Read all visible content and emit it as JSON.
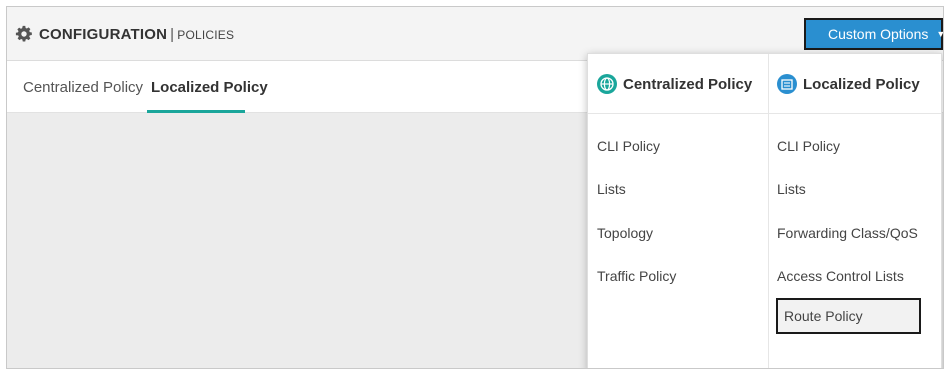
{
  "header": {
    "title_main": "CONFIGURATION",
    "separator": "|",
    "title_sub": "POLICIES",
    "custom_options_label": "Custom Options",
    "accent_color": "#2a8fd0"
  },
  "tabs": [
    {
      "label": "Centralized Policy",
      "active": false
    },
    {
      "label": "Localized Policy",
      "active": true
    }
  ],
  "tab_underline_color": "#1aa69b",
  "dropdown": {
    "centralized": {
      "heading": "Centralized Policy",
      "icon": "globe-icon",
      "items": [
        "CLI Policy",
        "Lists",
        "Topology",
        "Traffic Policy"
      ]
    },
    "localized": {
      "heading": "Localized Policy",
      "icon": "device-icon",
      "items": [
        "CLI Policy",
        "Lists",
        "Forwarding Class/QoS",
        "Access Control Lists",
        "Route Policy"
      ]
    }
  }
}
